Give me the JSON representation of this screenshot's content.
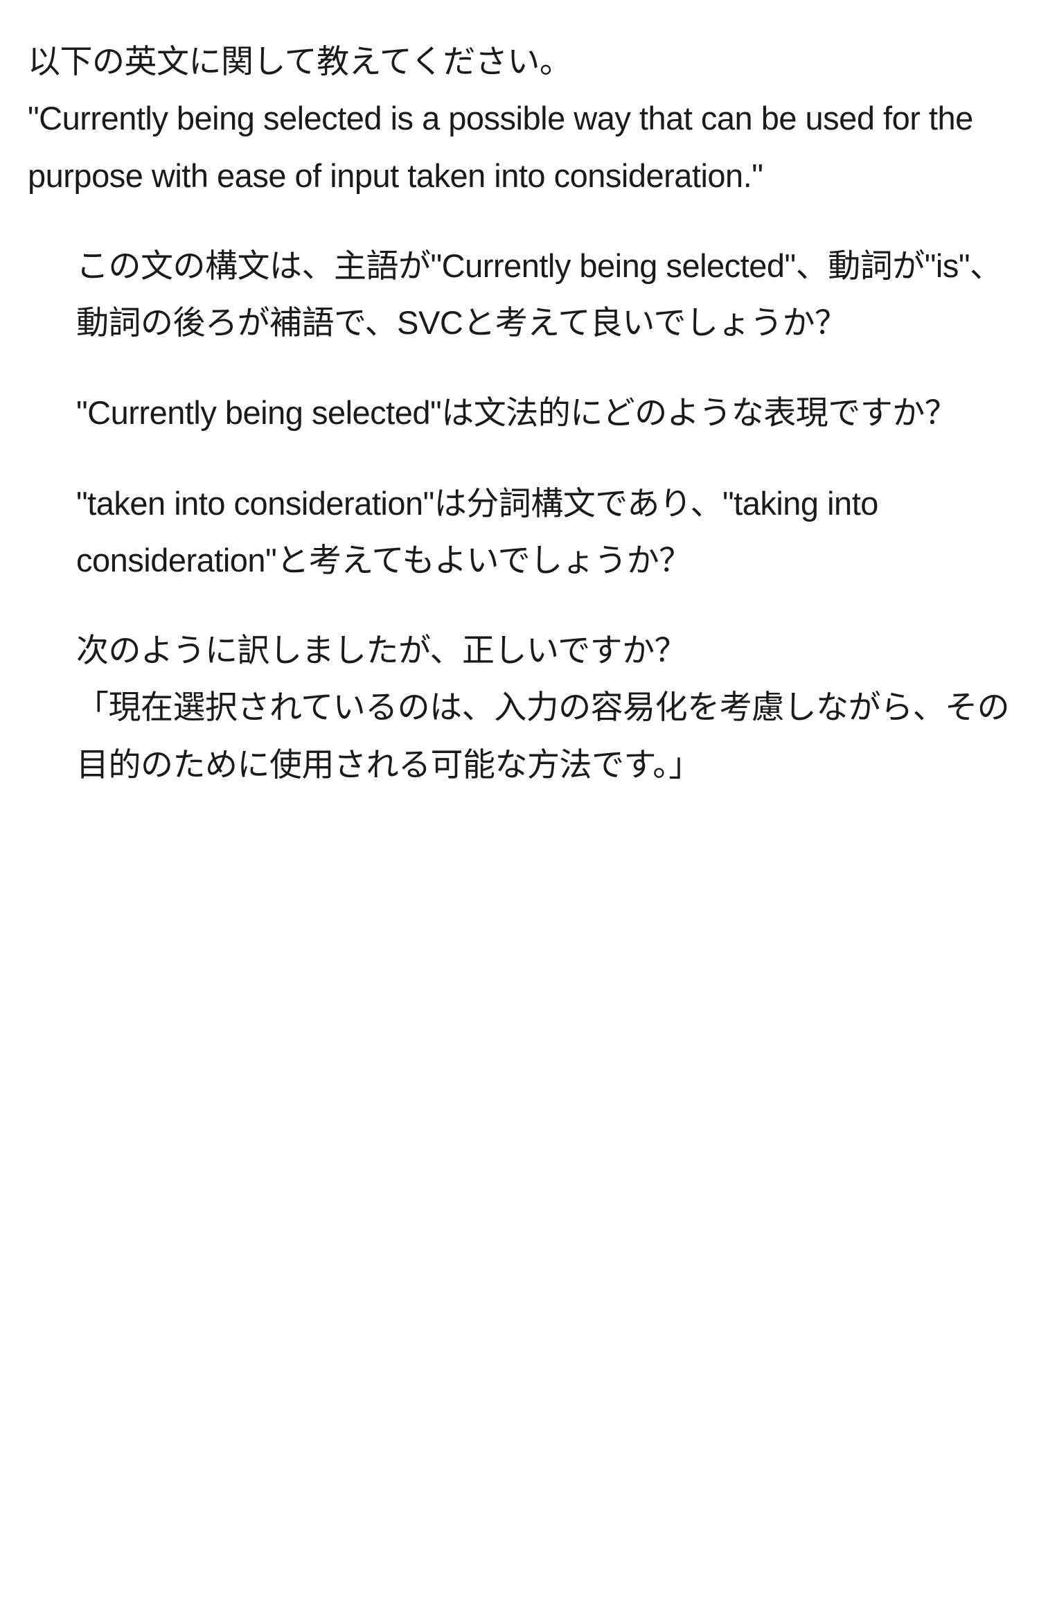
{
  "intro": {
    "line1": "以下の英文に関して教えてください。",
    "line2": "\"Currently being selected is a possible way that can be used for the purpose with ease of input taken into consideration.\""
  },
  "questions": [
    "この文の構文は、主語が\"Currently being selected\"、動詞が\"is\"、動詞の後ろが補語で、SVCと考えて良いでしょうか？",
    "\"Currently being selected\"は文法的にどのような表現ですか？",
    "\"taken into consideration\"は分詞構文であり、\"taking into consideration\"と考えてもよいでしょうか？",
    "次のように訳しましたが、正しいですか？\n「現在選択されているのは、入力の容易化を考慮しながら、その目的のために使用される可能な方法です。」"
  ]
}
